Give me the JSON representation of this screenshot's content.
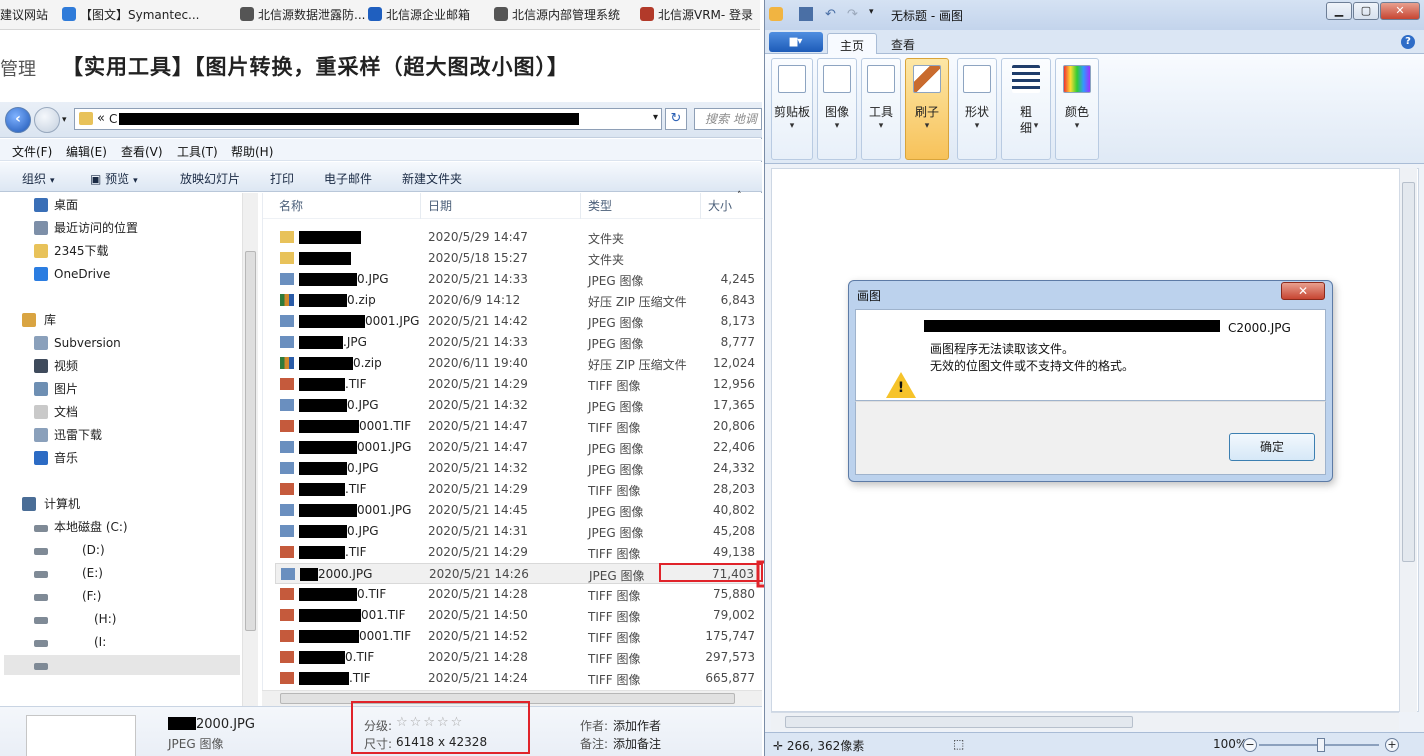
{
  "bookmarks": [
    {
      "label": "建议网站",
      "color": "#f4f4f4"
    },
    {
      "label": "【图文】Symantec...",
      "color": "#2f7bd9"
    },
    {
      "label": "北信源数据泄露防...",
      "color": "#555555"
    },
    {
      "label": "北信源企业邮箱",
      "color": "#1f5fbf"
    },
    {
      "label": "北信源内部管理系统",
      "color": "#555555"
    },
    {
      "label": "北信源VRM- 登录",
      "color": "#b23a2a"
    }
  ],
  "webpage": {
    "manage": "管理",
    "title": "【实用工具】【图片转换，重采样（超大图改小图）】"
  },
  "explorer": {
    "address_prefix": "«",
    "address_visible": "C",
    "search_placeholder": "搜索 地调",
    "menu": [
      "文件(F)",
      "编辑(E)",
      "查看(V)",
      "工具(T)",
      "帮助(H)"
    ],
    "commands": [
      {
        "label": "组织",
        "caret": "▾"
      },
      {
        "label": "预览",
        "caret": "▾"
      },
      {
        "label": "放映幻灯片",
        "caret": ""
      },
      {
        "label": "打印",
        "caret": ""
      },
      {
        "label": "电子邮件",
        "caret": ""
      },
      {
        "label": "新建文件夹",
        "caret": ""
      }
    ],
    "nav": [
      {
        "label": "桌面",
        "icon": "desktop-icon",
        "color": "#3a6fb7"
      },
      {
        "label": "最近访问的位置",
        "icon": "recent-icon",
        "color": "#7d8fa8"
      },
      {
        "label": "2345下载",
        "icon": "folder-icon",
        "color": "#e8c25a"
      },
      {
        "label": "OneDrive",
        "icon": "cloud-icon",
        "color": "#2b7de1"
      },
      {
        "label": "库",
        "icon": "library-icon",
        "color": "#d9a441"
      },
      {
        "label": "Subversion",
        "icon": "library-icon",
        "color": "#8aa0bb"
      },
      {
        "label": "视频",
        "icon": "video-icon",
        "color": "#3f4b5c"
      },
      {
        "label": "图片",
        "icon": "pictures-icon",
        "color": "#6e8fb3"
      },
      {
        "label": "文档",
        "icon": "documents-icon",
        "color": "#c9c9c9"
      },
      {
        "label": "迅雷下载",
        "icon": "library-icon",
        "color": "#8aa0bb"
      },
      {
        "label": "音乐",
        "icon": "music-icon",
        "color": "#2c6bc4"
      },
      {
        "label": "计算机",
        "icon": "computer-icon",
        "color": "#4a6d96"
      },
      {
        "label": "本地磁盘 (C:)",
        "icon": "drive-icon",
        "color": "#7f8a96"
      },
      {
        "label": "(D:)",
        "icon": "drive-icon",
        "color": "#7f8a96"
      },
      {
        "label": "(E:)",
        "icon": "drive-icon",
        "color": "#7f8a96"
      },
      {
        "label": "(F:)",
        "icon": "drive-icon",
        "color": "#7f8a96"
      },
      {
        "label": "(H:)",
        "icon": "drive-icon",
        "color": "#7f8a96"
      },
      {
        "label": "(I:",
        "icon": "drive-icon",
        "color": "#7f8a96"
      }
    ],
    "columns": [
      "名称",
      "日期",
      "类型",
      "大小"
    ],
    "files": [
      {
        "name": "",
        "date": "2020/5/29 14:47",
        "type": "文件夹",
        "size": "",
        "kind": "folder"
      },
      {
        "name": "",
        "date": "2020/5/18 15:27",
        "type": "文件夹",
        "size": "",
        "kind": "folder"
      },
      {
        "name": "0.JPG",
        "date": "2020/5/21 14:33",
        "type": "JPEG 图像",
        "size": "4,245",
        "kind": "jpg"
      },
      {
        "name": "0.zip",
        "date": "2020/6/9 14:12",
        "type": "好压 ZIP 压缩文件",
        "size": "6,843",
        "kind": "zip"
      },
      {
        "name": "0001.JPG",
        "date": "2020/5/21 14:42",
        "type": "JPEG 图像",
        "size": "8,173",
        "kind": "jpg"
      },
      {
        "name": ".JPG",
        "date": "2020/5/21 14:33",
        "type": "JPEG 图像",
        "size": "8,777",
        "kind": "jpg"
      },
      {
        "name": "0.zip",
        "date": "2020/6/11 19:40",
        "type": "好压 ZIP 压缩文件",
        "size": "12,024",
        "kind": "zip"
      },
      {
        "name": ".TIF",
        "date": "2020/5/21 14:29",
        "type": "TIFF 图像",
        "size": "12,956",
        "kind": "tif"
      },
      {
        "name": "0.JPG",
        "date": "2020/5/21 14:32",
        "type": "JPEG 图像",
        "size": "17,365",
        "kind": "jpg"
      },
      {
        "name": "0001.TIF",
        "date": "2020/5/21 14:47",
        "type": "TIFF 图像",
        "size": "20,806",
        "kind": "tif"
      },
      {
        "name": "0001.JPG",
        "date": "2020/5/21 14:47",
        "type": "JPEG 图像",
        "size": "22,406",
        "kind": "jpg"
      },
      {
        "name": "0.JPG",
        "date": "2020/5/21 14:32",
        "type": "JPEG 图像",
        "size": "24,332",
        "kind": "jpg"
      },
      {
        "name": ".TIF",
        "date": "2020/5/21 14:29",
        "type": "TIFF 图像",
        "size": "28,203",
        "kind": "tif"
      },
      {
        "name": "0001.JPG",
        "date": "2020/5/21 14:45",
        "type": "JPEG 图像",
        "size": "40,802",
        "kind": "jpg"
      },
      {
        "name": "0.JPG",
        "date": "2020/5/21 14:31",
        "type": "JPEG 图像",
        "size": "45,208",
        "kind": "jpg"
      },
      {
        "name": ".TIF",
        "date": "2020/5/21 14:29",
        "type": "TIFF 图像",
        "size": "49,138",
        "kind": "tif"
      },
      {
        "name": "2000.JPG",
        "date": "2020/5/21 14:26",
        "type": "JPEG 图像",
        "size": "71,403",
        "kind": "jpg",
        "selected": true
      },
      {
        "name": "0.TIF",
        "date": "2020/5/21 14:28",
        "type": "TIFF 图像",
        "size": "75,880",
        "kind": "tif"
      },
      {
        "name": "001.TIF",
        "date": "2020/5/21 14:50",
        "type": "TIFF 图像",
        "size": "79,002",
        "kind": "tif"
      },
      {
        "name": "0001.TIF",
        "date": "2020/5/21 14:52",
        "type": "TIFF 图像",
        "size": "175,747",
        "kind": "tif"
      },
      {
        "name": "0.TIF",
        "date": "2020/5/21 14:28",
        "type": "TIFF 图像",
        "size": "297,573",
        "kind": "tif"
      },
      {
        "name": ".TIF",
        "date": "2020/5/21 14:24",
        "type": "TIFF 图像",
        "size": "665,877",
        "kind": "tif"
      }
    ],
    "details": {
      "filename": "2000.JPG",
      "filetype": "JPEG 图像",
      "rating_label": "分级:",
      "rating_stars": "☆☆☆☆☆",
      "rating_value": 0,
      "dimensions_label": "尺寸:",
      "dimensions": "61418 x 42328",
      "author_label": "作者:",
      "author_value": "添加作者",
      "notes_label": "备注:",
      "notes_value": "添加备注"
    }
  },
  "paint": {
    "title": "无标题 - 画图",
    "tabs": [
      "主页",
      "查看"
    ],
    "ribbon": [
      {
        "label": "剪贴板",
        "icon": "clipboard-icon",
        "caret": "▾"
      },
      {
        "label": "图像",
        "icon": "image-select-icon",
        "caret": "▾"
      },
      {
        "label": "工具",
        "icon": "tools-icon",
        "caret": "▾"
      },
      {
        "label": "刷子",
        "icon": "brush-icon",
        "caret": "▾"
      },
      {
        "label": "形状",
        "icon": "shapes-icon",
        "caret": "▾"
      },
      {
        "label": "粗",
        "label2": "细",
        "icon": "size-icon",
        "caret": "▾"
      },
      {
        "label": "颜色",
        "icon": "colors-icon",
        "caret": "▾"
      }
    ],
    "status": {
      "cursor": "266, 362像素",
      "zoom": "100%",
      "zoom_minus": "−",
      "zoom_plus": "+"
    }
  },
  "dialog": {
    "title": "画图",
    "close": "✕",
    "line1_visible": "C2000.JPG",
    "line2": "画图程序无法读取该文件。",
    "line3": "无效的位图文件或不支持文件的格式。",
    "ok": "确定"
  },
  "colors": {
    "annotation_red": "#e0232a",
    "selection_bg": "#f0f0f0",
    "warning_yellow": "#f6c32a"
  }
}
